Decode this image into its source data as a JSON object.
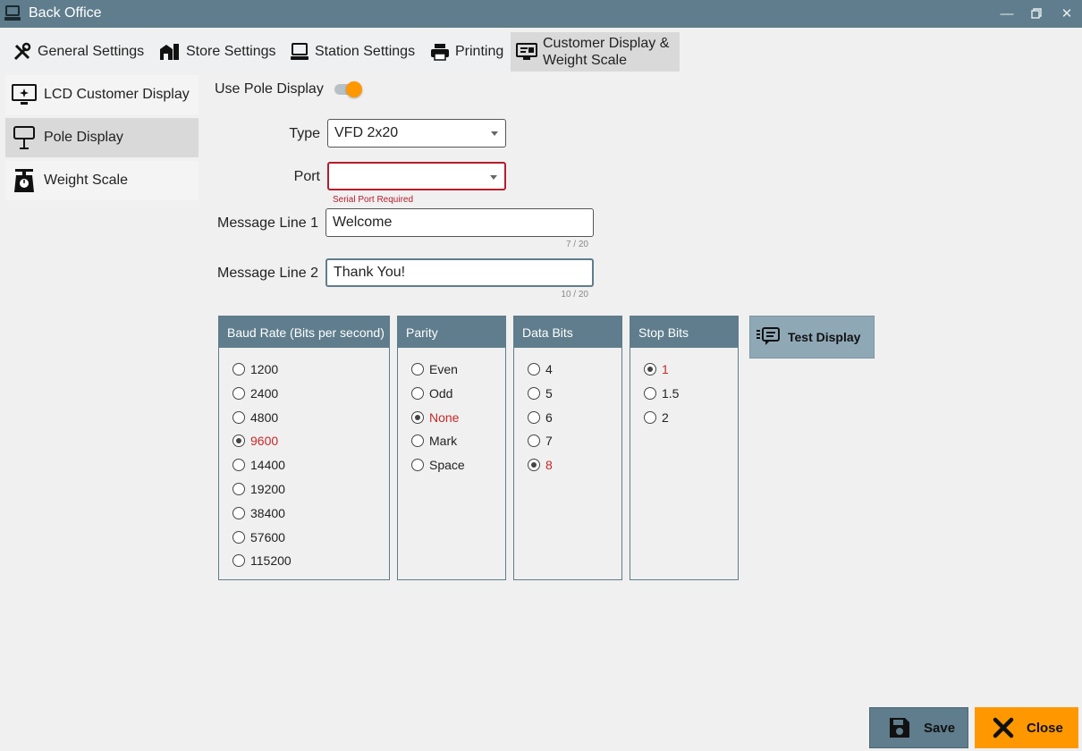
{
  "window": {
    "title": "Back Office",
    "controls": [
      "minimize-icon",
      "restore-icon",
      "close-icon"
    ]
  },
  "tabs": [
    {
      "label": "General Settings",
      "icon": "tools-icon"
    },
    {
      "label": "Store Settings",
      "icon": "store-icon"
    },
    {
      "label": "Station Settings",
      "icon": "computer-icon"
    },
    {
      "label": "Printing",
      "icon": "printer-icon"
    },
    {
      "label_line1": "Customer Display &",
      "label_line2": "Weight Scale",
      "icon": "customer-display-icon",
      "active": true
    }
  ],
  "sidebar": {
    "items": [
      {
        "label": "LCD Customer Display",
        "icon": "monitor-sparkle-icon"
      },
      {
        "label": "Pole Display",
        "icon": "pole-display-icon",
        "active": true
      },
      {
        "label": "Weight Scale",
        "icon": "scale-icon"
      }
    ]
  },
  "form": {
    "use_pole_display_label": "Use Pole Display",
    "use_pole_display": true,
    "type_label": "Type",
    "type_value": "VFD 2x20",
    "port_label": "Port",
    "port_value": "",
    "port_error": "Serial Port Required",
    "message1_label": "Message Line 1",
    "message1_value": "Welcome",
    "message1_counter": "7 / 20",
    "message2_label": "Message Line 2",
    "message2_value": "Thank You!",
    "message2_counter": "10 / 20"
  },
  "groups": {
    "baud": {
      "title": "Baud Rate (Bits per second)",
      "options": [
        "1200",
        "2400",
        "4800",
        "9600",
        "14400",
        "19200",
        "38400",
        "57600",
        "115200"
      ],
      "selected": "9600"
    },
    "parity": {
      "title": "Parity",
      "options": [
        "Even",
        "Odd",
        "None",
        "Mark",
        "Space"
      ],
      "selected": "None"
    },
    "databits": {
      "title": "Data Bits",
      "options": [
        "4",
        "5",
        "6",
        "7",
        "8"
      ],
      "selected": "8"
    },
    "stopbits": {
      "title": "Stop Bits",
      "options": [
        "1",
        "1.5",
        "2"
      ],
      "selected": "1"
    }
  },
  "buttons": {
    "test_display": "Test Display",
    "save": "Save",
    "close": "Close"
  }
}
